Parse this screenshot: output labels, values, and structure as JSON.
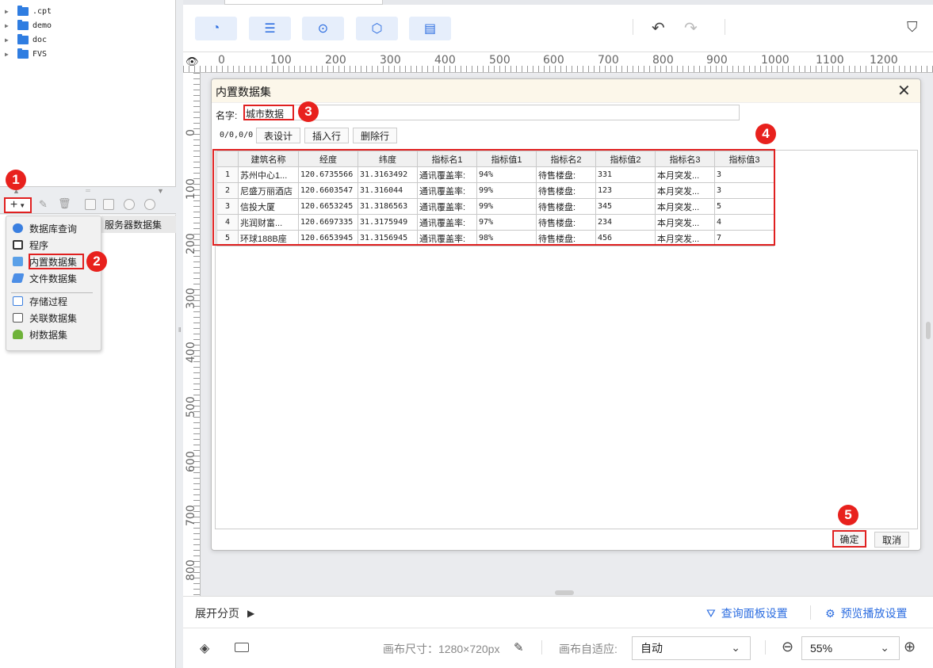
{
  "file_tree": {
    "items": [
      ".cpt",
      "demo",
      "doc",
      "FVS"
    ]
  },
  "datasource": {
    "server_dataset_label": "服务器数据集"
  },
  "add_menu": {
    "items": [
      "数据库查询",
      "程序",
      "内置数据集",
      "文件数据集",
      "存储过程",
      "关联数据集",
      "树数据集"
    ]
  },
  "badges": [
    "1",
    "2",
    "3",
    "4",
    "5"
  ],
  "ruler": {
    "h": [
      "0",
      "100",
      "200",
      "300",
      "400",
      "500",
      "600",
      "700",
      "800",
      "900",
      "1000",
      "1100",
      "1200"
    ],
    "v": [
      "0",
      "100",
      "200",
      "300",
      "400",
      "500",
      "600",
      "700",
      "800"
    ]
  },
  "dialog": {
    "title": "内置数据集",
    "name_label": "名字:",
    "name_value": "城市数据",
    "position": "0/0,0/0",
    "btn_design": "表设计",
    "btn_insert": "插入行",
    "btn_delete": "删除行",
    "columns": [
      "建筑名称",
      "经度",
      "纬度",
      "指标名1",
      "指标值1",
      "指标名2",
      "指标值2",
      "指标名3",
      "指标值3"
    ],
    "rows": [
      [
        "1",
        "苏州中心1...",
        "120.6735566",
        "31.3163492",
        "通讯覆盖率:",
        "94%",
        "待售楼盘:",
        "331",
        "本月突发...",
        "3"
      ],
      [
        "2",
        "尼盛万丽酒店",
        "120.6603547",
        "31.316044",
        "通讯覆盖率:",
        "99%",
        "待售楼盘:",
        "123",
        "本月突发...",
        "3"
      ],
      [
        "3",
        "信投大厦",
        "120.6653245",
        "31.3186563",
        "通讯覆盖率:",
        "99%",
        "待售楼盘:",
        "345",
        "本月突发...",
        "5"
      ],
      [
        "4",
        "兆润财富...",
        "120.6697335",
        "31.3175949",
        "通讯覆盖率:",
        "97%",
        "待售楼盘:",
        "234",
        "本月突发...",
        "4"
      ],
      [
        "5",
        "环球188B座",
        "120.6653945",
        "31.3156945",
        "通讯覆盖率:",
        "98%",
        "待售楼盘:",
        "456",
        "本月突发...",
        "7"
      ]
    ],
    "ok_label": "确定",
    "cancel_label": "取消"
  },
  "bottom": {
    "expand_label": "展开分页",
    "query_panel": "查询面板设置",
    "preview_play": "预览播放设置",
    "canvas_size": "画布尺寸：1280×720px",
    "canvas_fit_label": "画布自适应:",
    "canvas_fit_value": "自动",
    "zoom_value": "55%"
  },
  "colors": {
    "accent": "#2c6de0",
    "highlight": "#e02020",
    "badge": "#e8211d"
  }
}
